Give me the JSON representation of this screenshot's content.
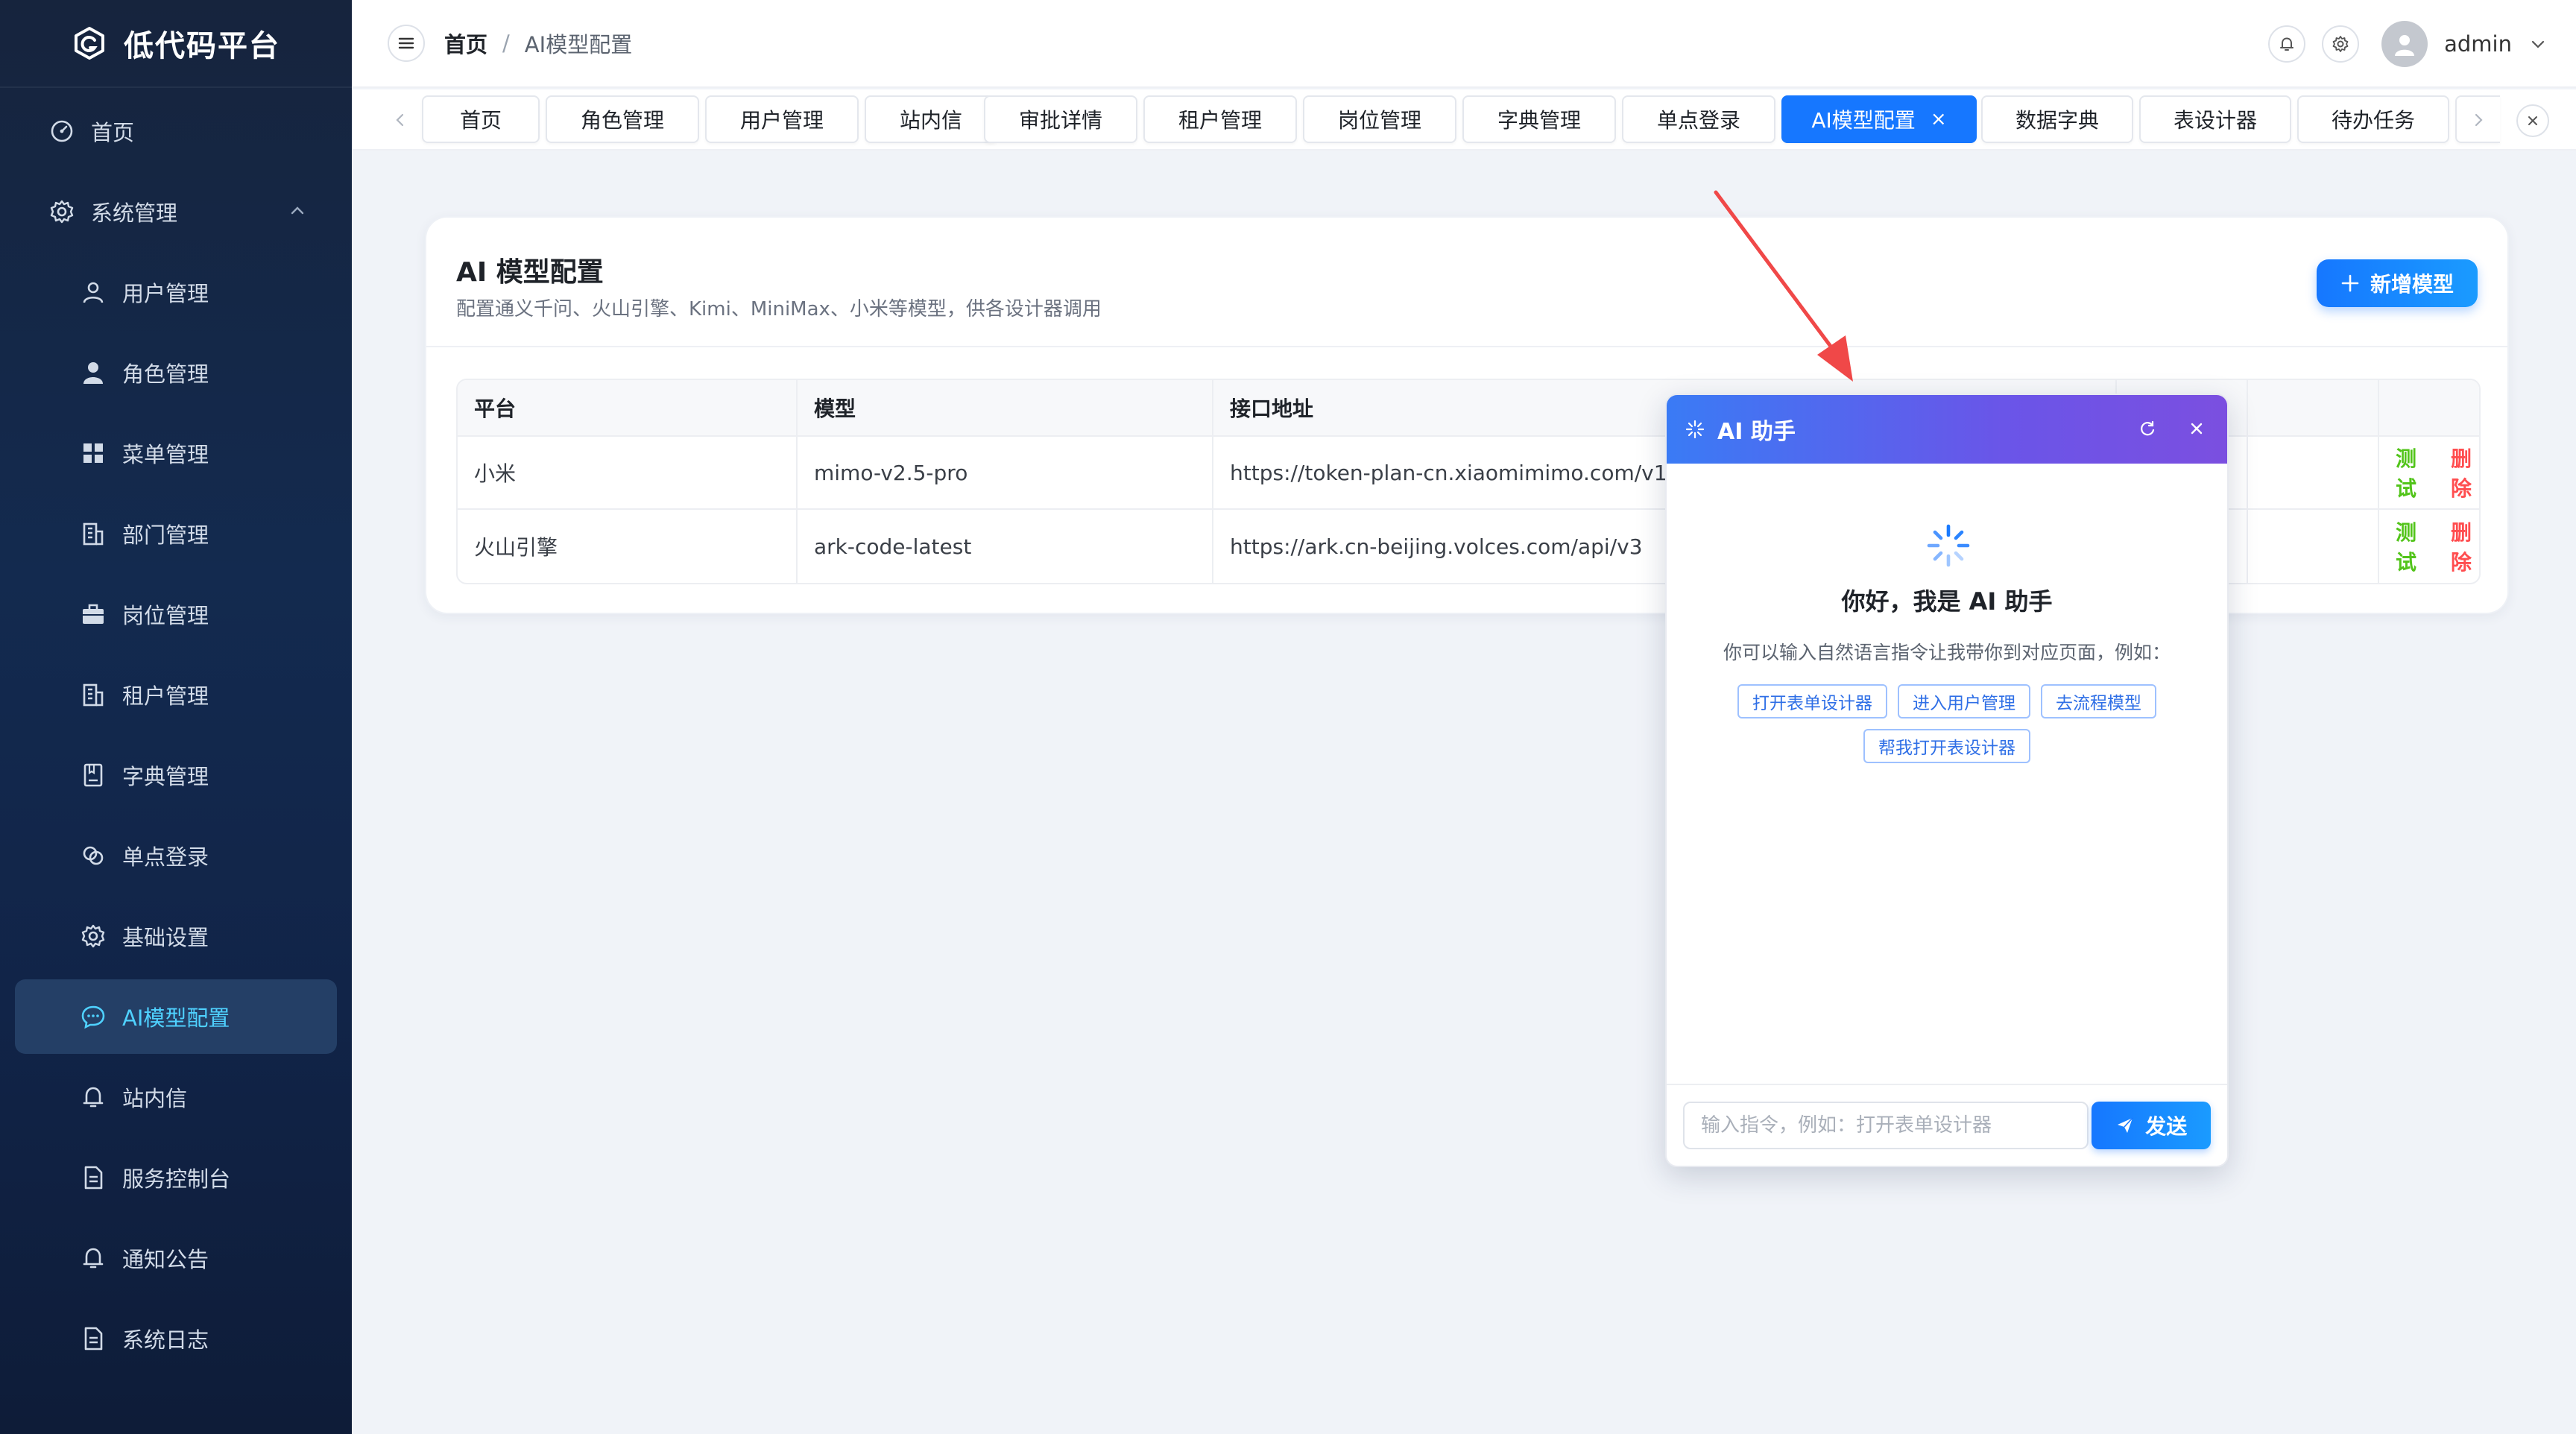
{
  "app": {
    "title": "低代码平台"
  },
  "sidebar": {
    "items": [
      {
        "label": "首页",
        "icon": "dashboard-icon"
      },
      {
        "label": "系统管理",
        "icon": "settings-icon",
        "expanded": true
      },
      {
        "label": "用户管理",
        "icon": "user-icon"
      },
      {
        "label": "角色管理",
        "icon": "role-icon"
      },
      {
        "label": "菜单管理",
        "icon": "grid-icon"
      },
      {
        "label": "部门管理",
        "icon": "building-icon"
      },
      {
        "label": "岗位管理",
        "icon": "briefcase-icon"
      },
      {
        "label": "租户管理",
        "icon": "building-icon"
      },
      {
        "label": "字典管理",
        "icon": "book-icon"
      },
      {
        "label": "单点登录",
        "icon": "link-icon"
      },
      {
        "label": "基础设置",
        "icon": "gear-icon"
      },
      {
        "label": "AI模型配置",
        "icon": "chat-icon",
        "active": true
      },
      {
        "label": "站内信",
        "icon": "bell-icon"
      },
      {
        "label": "服务控制台",
        "icon": "file-icon"
      },
      {
        "label": "通知公告",
        "icon": "bell-icon"
      },
      {
        "label": "系统日志",
        "icon": "file-icon"
      }
    ]
  },
  "header": {
    "breadcrumb_home": "首页",
    "breadcrumb_sep": "/",
    "breadcrumb_current": "AI模型配置",
    "username": "admin"
  },
  "tabs": [
    {
      "label": "首页"
    },
    {
      "label": "角色管理"
    },
    {
      "label": "用户管理"
    },
    {
      "label": "站内信"
    },
    {
      "label": "审批详情"
    },
    {
      "label": "租户管理"
    },
    {
      "label": "岗位管理"
    },
    {
      "label": "字典管理"
    },
    {
      "label": "单点登录"
    },
    {
      "label": "AI模型配置",
      "active": true,
      "close": "×"
    },
    {
      "label": "数据字典"
    },
    {
      "label": "表设计器"
    },
    {
      "label": "待办任务"
    }
  ],
  "card": {
    "title": "AI 模型配置",
    "subtitle": "配置通义千问、火山引擎、Kimi、MiniMax、小米等模型，供各设计器调用",
    "add_button": "新增模型",
    "columns": [
      "平台",
      "模型",
      "接口地址",
      "",
      "",
      ""
    ],
    "rows": [
      {
        "platform": "小米",
        "model": "mimo-v2.5-pro",
        "endpoint": "https://token-plan-cn.xiaomimimo.com/v1",
        "test": "测试",
        "delete": "删除"
      },
      {
        "platform": "火山引擎",
        "model": "ark-code-latest",
        "endpoint": "https://ark.cn-beijing.volces.com/api/v3",
        "test": "测试",
        "delete": "删除"
      }
    ]
  },
  "ai_assistant": {
    "title": "AI 助手",
    "greeting": "你好，我是 AI 助手",
    "hint": "你可以输入自然语言指令让我带你到对应页面，例如：",
    "suggestions": [
      "打开表单设计器",
      "进入用户管理",
      "去流程模型",
      "帮我打开表设计器"
    ],
    "input_placeholder": "输入指令，例如：打开表单设计器",
    "send_button": "发送"
  },
  "colors": {
    "primary": "#1677ff",
    "sidebar_bg": "#132a4f",
    "active_text": "#4fd1ff",
    "success": "#52c41a",
    "danger": "#ff4d4f",
    "annotation_arrow": "#f04848"
  }
}
